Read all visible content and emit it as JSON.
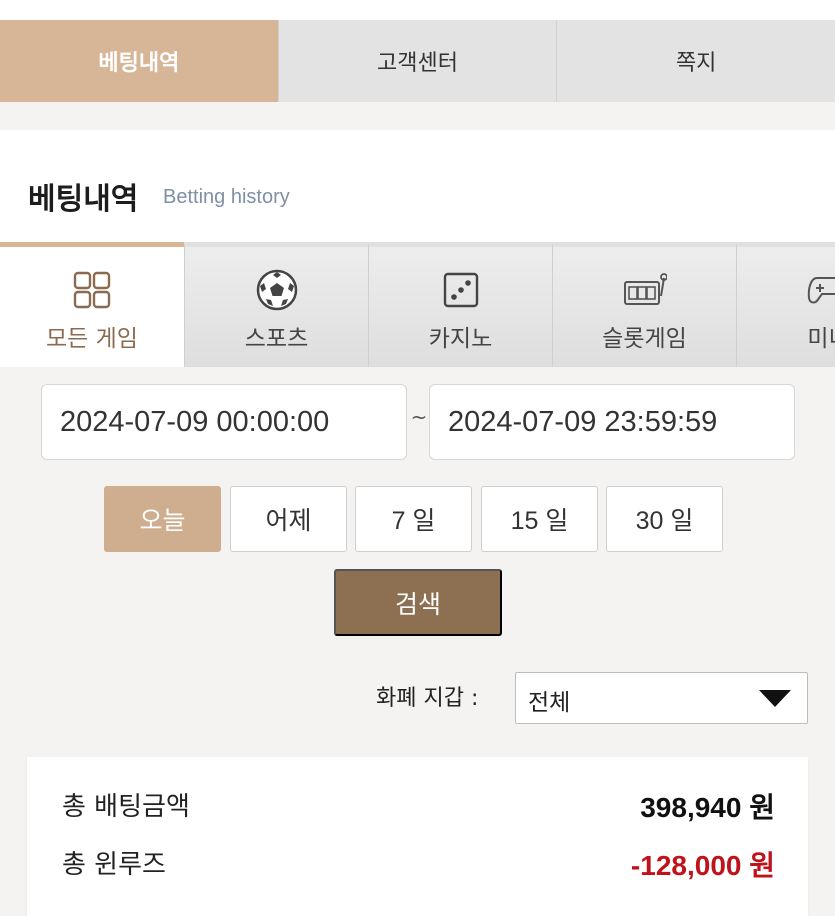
{
  "top_tabs": [
    {
      "label": "베팅내역",
      "active": true
    },
    {
      "label": "고객센터",
      "active": false
    },
    {
      "label": "쪽지",
      "active": false
    }
  ],
  "page": {
    "title": "베팅내역",
    "subtitle": "Betting history"
  },
  "game_tabs": [
    {
      "label": "모든 게임",
      "icon": "grid-icon",
      "active": true
    },
    {
      "label": "스포츠",
      "icon": "soccer-ball-icon",
      "active": false
    },
    {
      "label": "카지노",
      "icon": "dice-icon",
      "active": false
    },
    {
      "label": "슬롯게임",
      "icon": "slot-machine-icon",
      "active": false
    },
    {
      "label": "미니",
      "icon": "gamepad-icon",
      "active": false
    }
  ],
  "date_range": {
    "from": "2024-07-09 00:00:00",
    "separator": "~",
    "to": "2024-07-09 23:59:59"
  },
  "period_buttons": [
    {
      "label": "오늘",
      "active": true
    },
    {
      "label": "어제",
      "active": false
    },
    {
      "label": "7 일",
      "active": false
    },
    {
      "label": "15 일",
      "active": false
    },
    {
      "label": "30 일",
      "active": false
    }
  ],
  "search_button": "검색",
  "wallet": {
    "label": "화폐 지갑 :",
    "selected": "전체"
  },
  "summary": {
    "total_bet_label": "총 배팅금액",
    "total_bet_value": "398,940 원",
    "total_winloss_label": "총 윈루즈",
    "total_winloss_value": "-128,000 원"
  },
  "colors": {
    "accent": "#d7b597",
    "search_button": "#8d6f52",
    "negative": "#c0121b"
  }
}
